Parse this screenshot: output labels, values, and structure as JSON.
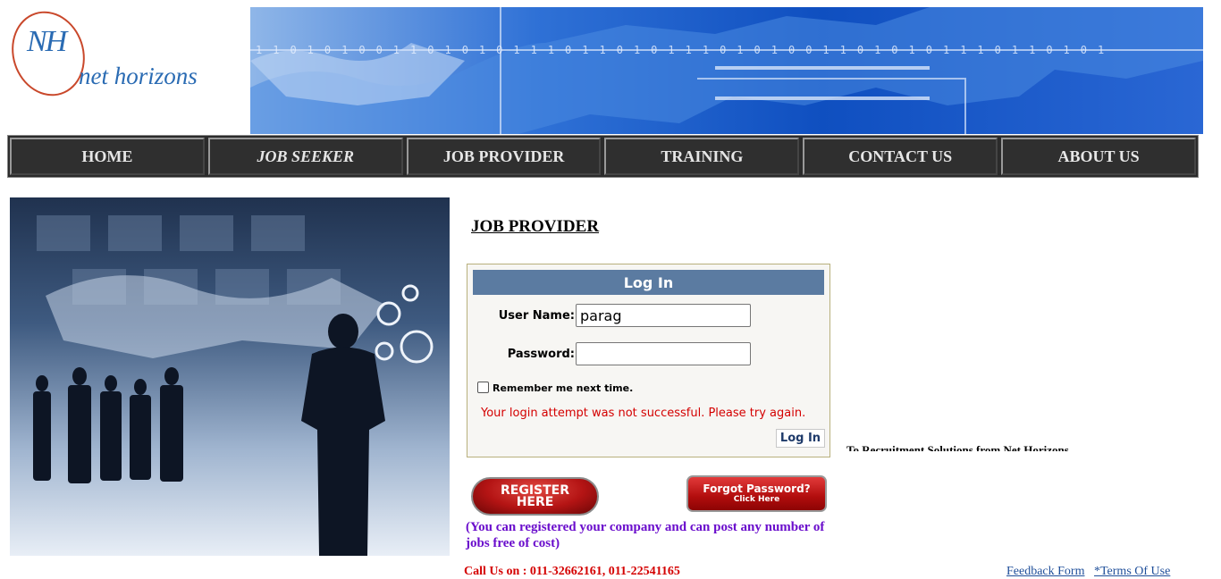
{
  "header": {
    "logo_monogram": "NH",
    "logo_text": "net horizons",
    "banner_bits": "1101010011010101110110101"
  },
  "nav": {
    "items": [
      {
        "label": "HOME"
      },
      {
        "label": "JOB SEEKER"
      },
      {
        "label": "JOB PROVIDER"
      },
      {
        "label": "TRAINING"
      },
      {
        "label": "CONTACT US"
      },
      {
        "label": "ABOUT US"
      }
    ]
  },
  "page": {
    "title": "JOB PROVIDER"
  },
  "login": {
    "heading": "Log In",
    "username_label": "User Name:",
    "username_value": "parag",
    "password_label": "Password:",
    "password_value": "",
    "remember_label": "Remember me next time.",
    "remember_checked": false,
    "error_message": "Your login attempt was not successful. Please try again.",
    "submit_label": "Log In"
  },
  "register": {
    "button_line1": "REGISTER",
    "button_line2": "HERE",
    "note": "(You can registered your company and can post any number of jobs free of cost)"
  },
  "forgot": {
    "line1": "Forgot Password?",
    "line2": "Click Here"
  },
  "marquee_text": "To Recruitment Solutions from Net Horizons",
  "footer": {
    "call_us": "Call Us on :    011-32662161, 011-22541165",
    "feedback_link": "Feedback Form",
    "terms_link": "*Terms Of Use"
  },
  "colors": {
    "nav_bg": "#2f2f2f",
    "login_header": "#5b7ba1",
    "error_text": "#d40000",
    "note_text": "#6a0dcc"
  }
}
